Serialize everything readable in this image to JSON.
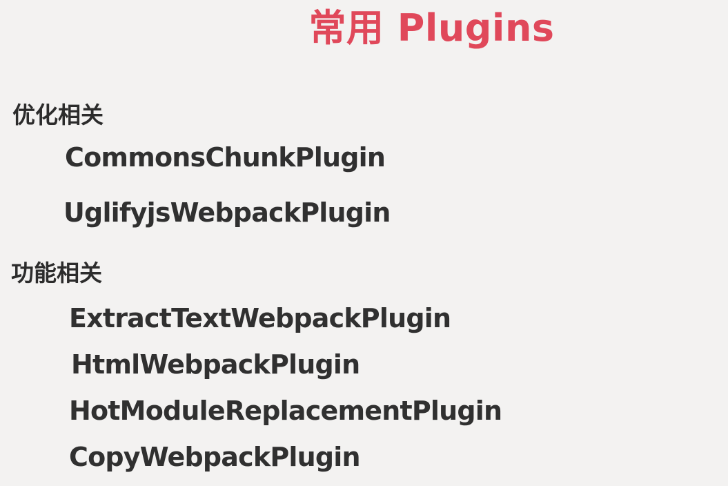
{
  "title": "常用 Plugins",
  "sections": [
    {
      "heading": "优化相关",
      "items": [
        "CommonsChunkPlugin",
        "UglifyjsWebpackPlugin"
      ]
    },
    {
      "heading": "功能相关",
      "items": [
        "ExtractTextWebpackPlugin",
        "HtmlWebpackPlugin",
        "HotModuleReplacementPlugin",
        "CopyWebpackPlugin"
      ]
    }
  ]
}
